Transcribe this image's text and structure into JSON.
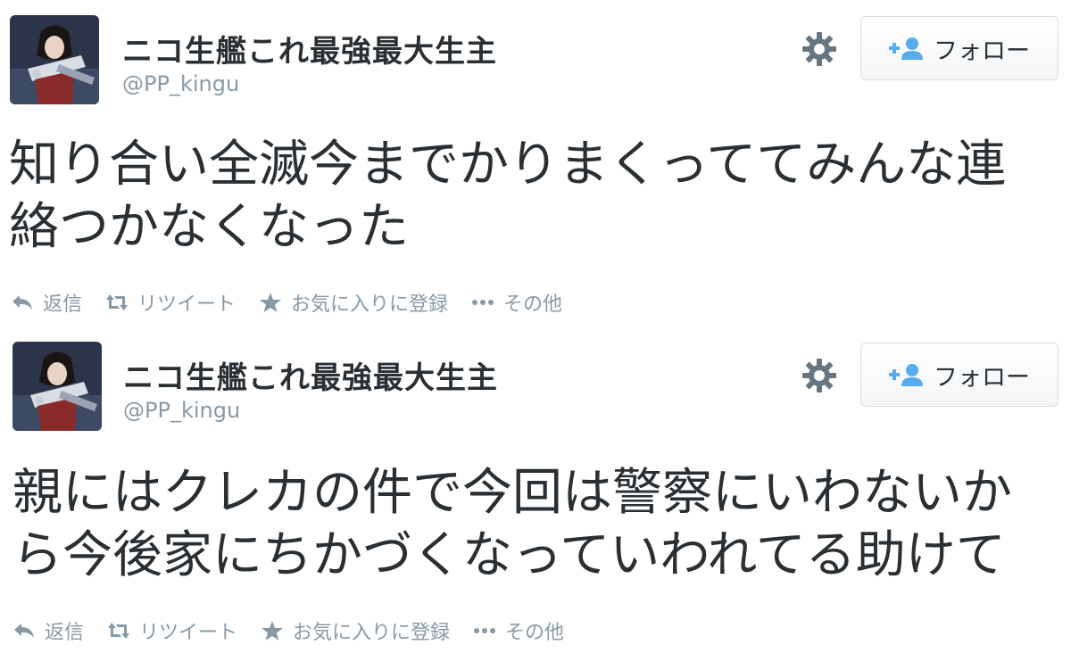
{
  "tweets": [
    {
      "display_name": "ニコ生艦これ最強最大生主",
      "screen_name": "@PP_kingu",
      "follow_label": "フォロー",
      "text_lines": [
        "知り合い全滅今までかりまくっててみんな連",
        "絡つかなくなった"
      ],
      "actions": {
        "reply": "返信",
        "retweet": "リツイート",
        "favorite": "お気に入りに登録",
        "more": "その他"
      }
    },
    {
      "display_name": "ニコ生艦これ最強最大生主",
      "screen_name": "@PP_kingu",
      "follow_label": "フォロー",
      "text_lines": [
        "親にはクレカの件で今回は警察にいわないか",
        "ら今後家にちかづくなっていわれてる助けて"
      ],
      "actions": {
        "reply": "返信",
        "retweet": "リツイート",
        "favorite": "お気に入りに登録",
        "more": "その他"
      }
    }
  ],
  "colors": {
    "text": "#292f33",
    "muted": "#8899a6",
    "follow_icon": "#55acee",
    "button_border": "#d9dde1"
  },
  "icons": {
    "settings": "gear-icon",
    "follow": "add-user-icon",
    "reply": "reply-icon",
    "retweet": "retweet-icon",
    "favorite": "star-icon",
    "more": "more-icon"
  }
}
